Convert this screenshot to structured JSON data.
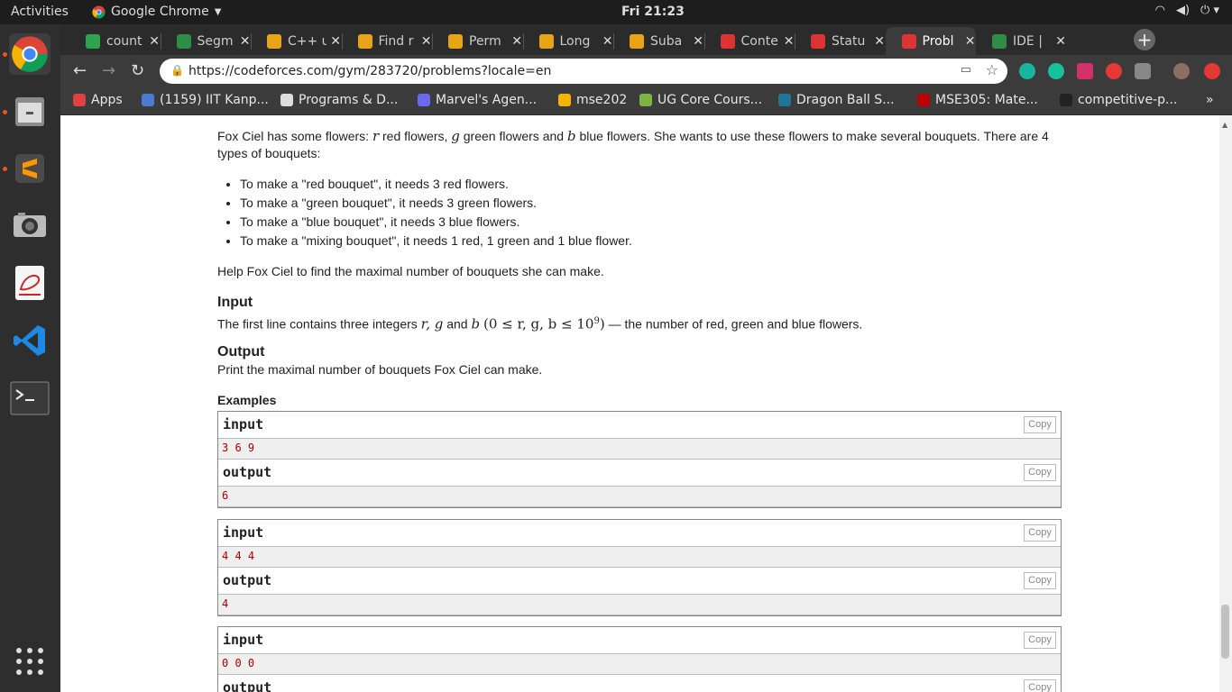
{
  "topbar": {
    "activities": "Activities",
    "app_name": "Google Chrome",
    "clock": "Fri 21:23"
  },
  "tabs": [
    {
      "title": "count",
      "fav": "#2ea44f"
    },
    {
      "title": "Segm",
      "fav": "#2f8d46"
    },
    {
      "title": "C++ u",
      "fav": "#e8a317"
    },
    {
      "title": "Find r",
      "fav": "#e8a317"
    },
    {
      "title": "Perm",
      "fav": "#e8a317"
    },
    {
      "title": "Long",
      "fav": "#e8a317"
    },
    {
      "title": "Suba",
      "fav": "#e8a317"
    },
    {
      "title": "Conte",
      "fav": "#d33"
    },
    {
      "title": "Statu",
      "fav": "#d33"
    },
    {
      "title": "Probl",
      "fav": "#d33"
    },
    {
      "title": "IDE |",
      "fav": "#2f8d46"
    }
  ],
  "url": "https://codeforces.com/gym/283720/problems?locale=en",
  "bookmarks": [
    {
      "label": "Apps",
      "color": "#e04040"
    },
    {
      "label": "(1159) IIT Kanp...",
      "color": "#4a7bd0"
    },
    {
      "label": "Programs & D...",
      "color": "#ddd"
    },
    {
      "label": "Marvel's Agen...",
      "color": "#6a6af0"
    },
    {
      "label": "mse202",
      "color": "#f4b400"
    },
    {
      "label": "UG Core Cours...",
      "color": "#7cb342"
    },
    {
      "label": "Dragon Ball S...",
      "color": "#21759b"
    },
    {
      "label": "MSE305: Mate...",
      "color": "#b00"
    },
    {
      "label": "competitive-p...",
      "color": "#222"
    }
  ],
  "problem": {
    "intro_pre": "Fox Ciel has some flowers: ",
    "intro_r": "r",
    "intro_mid1": " red flowers, ",
    "intro_g": "g",
    "intro_mid2": " green flowers and ",
    "intro_b": "b",
    "intro_post": " blue flowers. She wants to use these flowers to make several bouquets. There are 4 types of bouquets:",
    "bullets": [
      "To make a \"red bouquet\", it needs 3 red flowers.",
      "To make a \"green bouquet\", it needs 3 green flowers.",
      "To make a \"blue bouquet\", it needs 3 blue flowers.",
      "To make a \"mixing bouquet\", it needs 1 red, 1 green and 1 blue flower."
    ],
    "help": "Help Fox Ciel to find the maximal number of bouquets she can make.",
    "input_title": "Input",
    "input_pre": "The first line contains three integers ",
    "input_vars": "r, g",
    "input_and": " and ",
    "input_b": "b",
    "input_constraint": "(0 ≤ r, g, b ≤ 10",
    "input_exp": "9",
    "input_close": ")",
    "input_post": " — the number of red, green and blue flowers.",
    "output_title": "Output",
    "output_text": "Print the maximal number of bouquets Fox Ciel can make.",
    "examples_title": "Examples",
    "copy_label": "Copy",
    "input_label": "input",
    "output_label": "output",
    "examples": [
      {
        "input": "3 6 9",
        "output": "6"
      },
      {
        "input": "4 4 4",
        "output": "4"
      },
      {
        "input": "0 0 0",
        "output": ""
      }
    ]
  }
}
